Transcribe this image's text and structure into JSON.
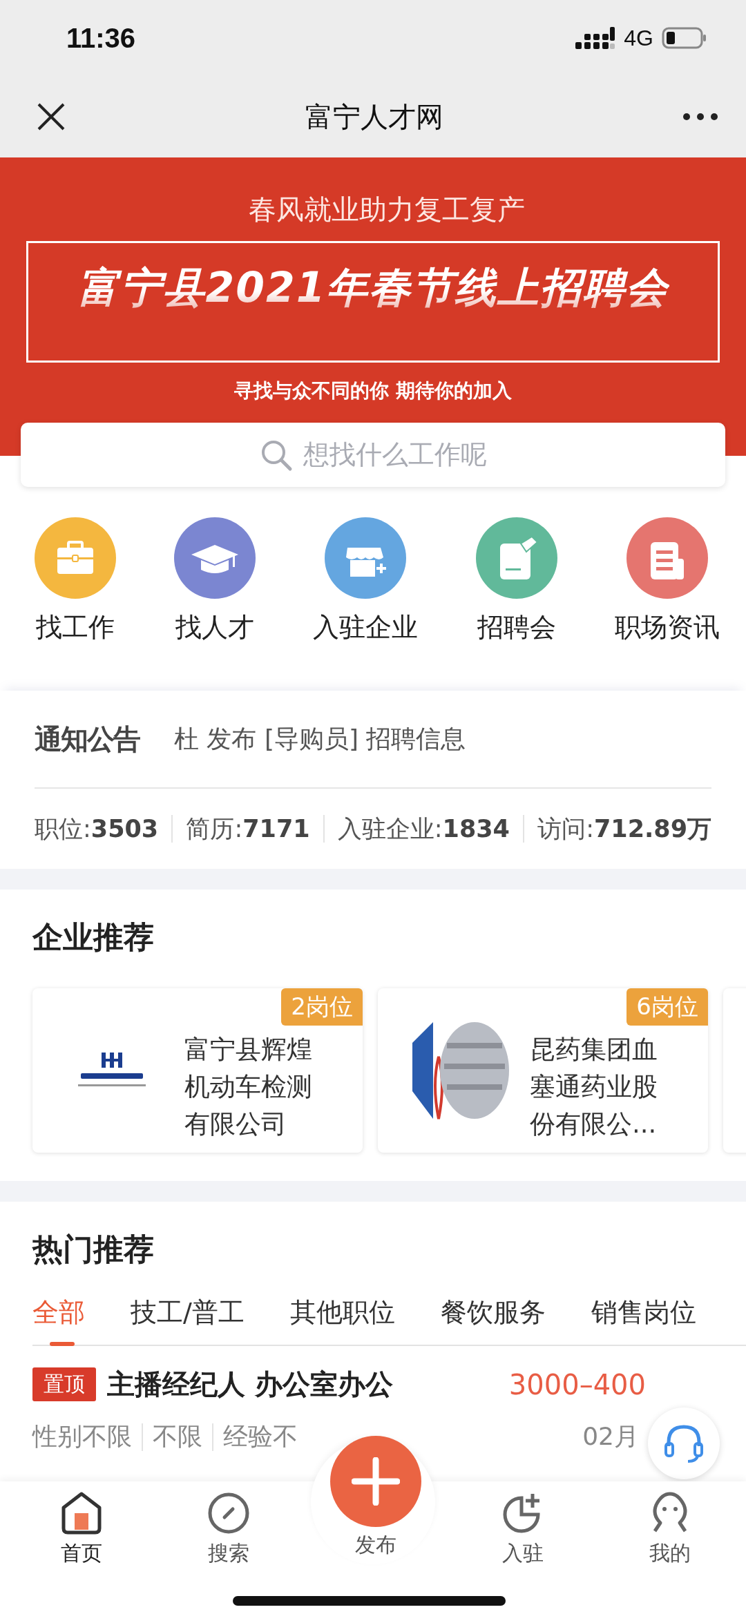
{
  "status_bar": {
    "time": "11:36",
    "network": "4G"
  },
  "nav_bar": {
    "title": "富宁人才网"
  },
  "banner": {
    "subtitle": "春风就业助力复工复产",
    "headline": "富宁县2021年春节线上招聘会",
    "tagline": "寻找与众不同的你 期待你的加入"
  },
  "search": {
    "placeholder": "想找什么工作呢"
  },
  "shortcuts": [
    {
      "label": "找工作",
      "kind": "briefcase",
      "color": "#f4b73f"
    },
    {
      "label": "找人才",
      "kind": "cap",
      "color": "#7b86d1"
    },
    {
      "label": "入驻企业",
      "kind": "store",
      "color": "#64a6e0"
    },
    {
      "label": "招聘会",
      "kind": "edit",
      "color": "#61b99a"
    },
    {
      "label": "职场资讯",
      "kind": "news",
      "color": "#e5756f"
    }
  ],
  "notice": {
    "label": "通知公告",
    "text": "杜 发布 [导购员] 招聘信息"
  },
  "stats": [
    {
      "label": "职位:",
      "value": "3503"
    },
    {
      "label": "简历:",
      "value": "7171"
    },
    {
      "label": "入驻企业:",
      "value": "1834"
    },
    {
      "label": "访问:",
      "value": "712.89万"
    }
  ],
  "featured_companies": {
    "title": "企业推荐",
    "cards": [
      {
        "kind": "inspection",
        "badge": "2岗位",
        "name": "富宁县辉煌机动车检测有限公司"
      },
      {
        "kind": "pharma",
        "badge": "6岗位",
        "name": "昆药集团血塞通药业股份有限公..."
      },
      {
        "kind": "cut_off"
      }
    ]
  },
  "hot": {
    "title": "热门推荐",
    "tabs": [
      {
        "label": "全部",
        "selected": true
      },
      {
        "label": "技工/普工",
        "selected": false
      },
      {
        "label": "其他职位",
        "selected": false
      },
      {
        "label": "餐饮服务",
        "selected": false
      },
      {
        "label": "销售岗位",
        "selected": false
      }
    ],
    "jobs": [
      {
        "pinned": true,
        "badge": "置顶",
        "title": "主播经纪人 办公室办公",
        "salary": "3000–400",
        "tags": [
          "性别不限",
          "不限",
          "经验不"
        ],
        "date": "02月"
      }
    ]
  },
  "tab_bar": [
    {
      "label": "首页",
      "kind": "home",
      "selected": true
    },
    {
      "label": "搜索",
      "kind": "compass",
      "selected": false
    },
    {
      "label": "发布",
      "kind": "publish",
      "selected": false
    },
    {
      "label": "入驻",
      "kind": "join",
      "selected": false
    },
    {
      "label": "我的",
      "kind": "me",
      "selected": false
    }
  ]
}
